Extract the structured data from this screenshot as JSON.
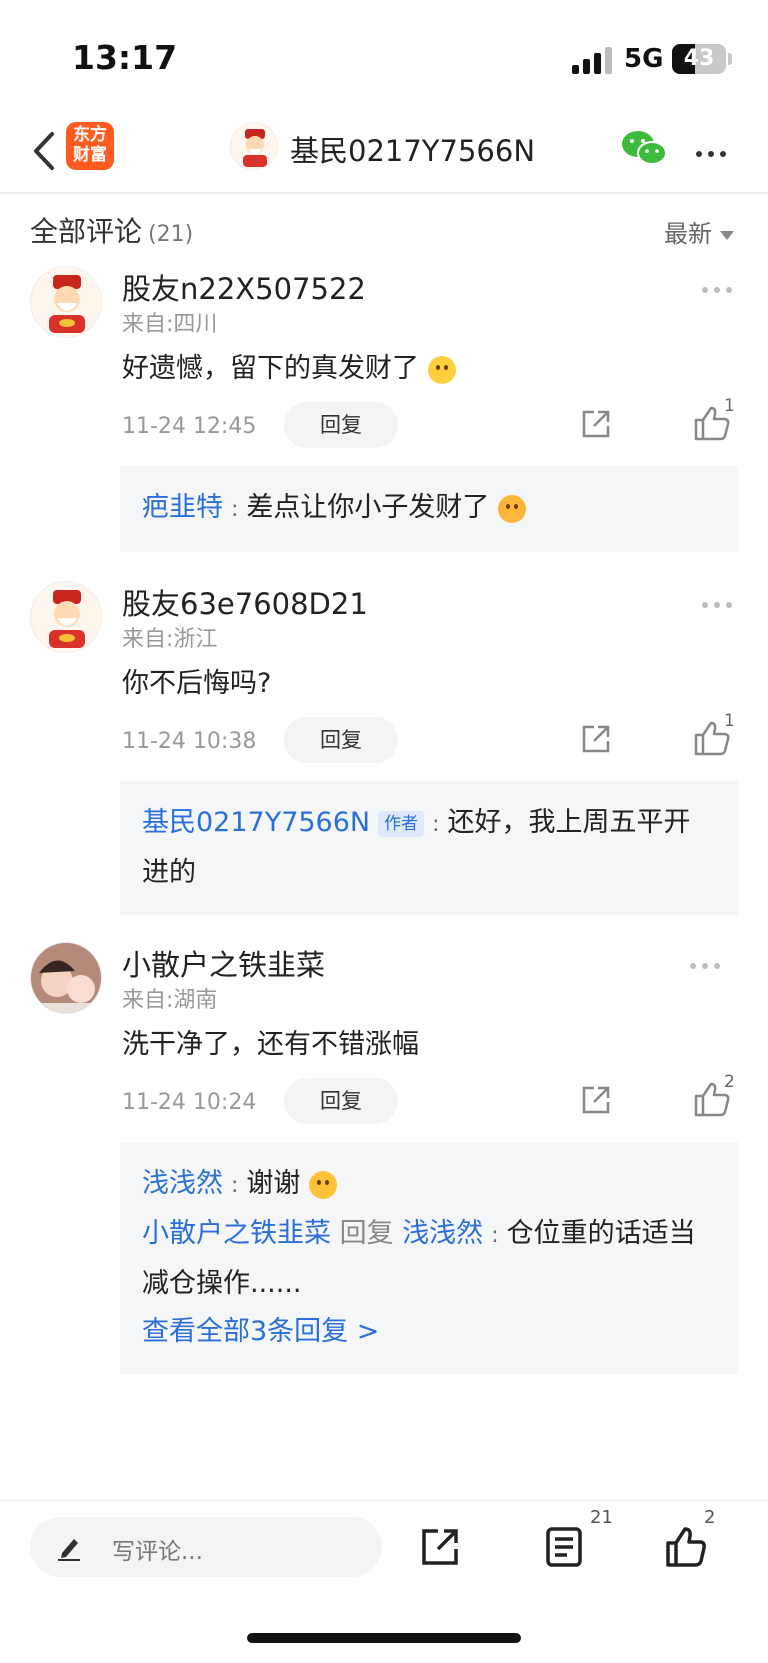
{
  "status_bar": {
    "time": "13:17",
    "network": "5G",
    "battery": "43",
    "battery_level": 0.43
  },
  "nav": {
    "logo_line1": "东方",
    "logo_line2": "财富",
    "title": "基民0217Y7566N"
  },
  "comments_header": {
    "label": "全部评论",
    "count": "(21)",
    "sort": "最新"
  },
  "comments": [
    {
      "user": "股友n22X507522",
      "from": "来自:四川",
      "text": "好遗憾，留下的真发财了",
      "text_emoji": "crying-emoji",
      "time": "11-24 12:45",
      "reply_label": "回复",
      "likes": "1",
      "replies": [
        {
          "user": "疤韭特",
          "text": "差点让你小子发财了",
          "emoji": "smile-emoji"
        }
      ]
    },
    {
      "user": "股友63e7608D21",
      "from": "来自:浙江",
      "text": "你不后悔吗?",
      "time": "11-24 10:38",
      "reply_label": "回复",
      "likes": "1",
      "replies": [
        {
          "user": "基民0217Y7566N",
          "tag": "作者",
          "text": "还好，我上周五平开进的"
        }
      ]
    },
    {
      "user": "小散户之铁韭菜",
      "from": "来自:湖南",
      "text": "洗干净了，还有不错涨幅",
      "time": "11-24 10:24",
      "reply_label": "回复",
      "likes": "2",
      "replies": [
        {
          "user": "浅浅然",
          "text": "谢谢",
          "emoji": "laughing-emoji"
        },
        {
          "user": "小散户之铁韭菜",
          "reply_word": "回复",
          "target": "浅浅然",
          "text": "仓位重的话适当减仓操作......"
        }
      ],
      "view_all": "查看全部3条回复 >"
    }
  ],
  "bottom_bar": {
    "placeholder": "写评论...",
    "comment_count": "21",
    "like_count": "2"
  },
  "colors": {
    "brand": "#ff5a1f",
    "link": "#2b6fd8",
    "reply_bg": "#f5f6f8"
  }
}
